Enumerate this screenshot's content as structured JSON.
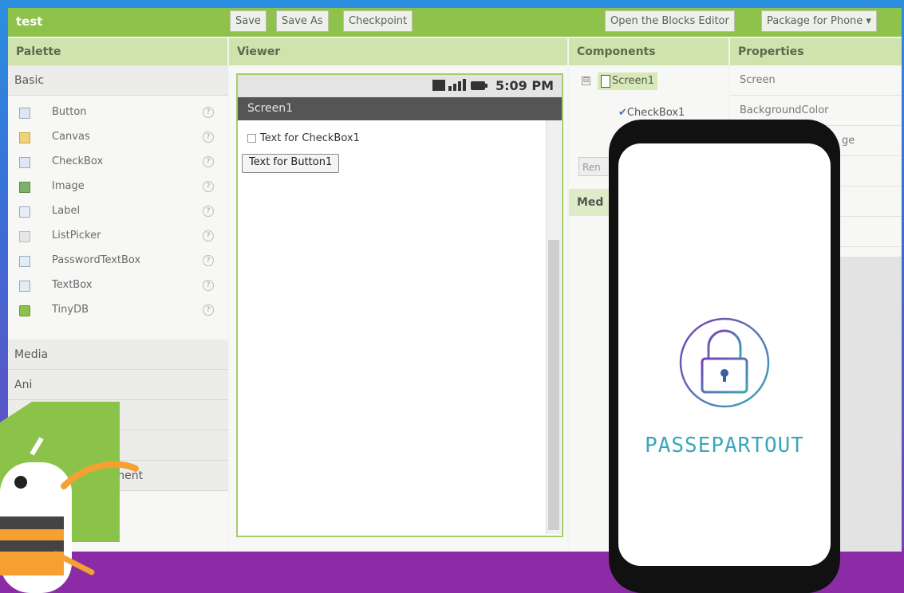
{
  "topbar": {
    "app_title": "test",
    "save": "Save",
    "save_as": "Save As",
    "checkpoint": "Checkpoint",
    "blocks_editor": "Open the Blocks Editor",
    "package": "Package for Phone ▾"
  },
  "columns": {
    "palette": "Palette",
    "viewer": "Viewer",
    "components": "Components",
    "properties": "Properties"
  },
  "palette": {
    "basic": "Basic",
    "items": [
      "Button",
      "Canvas",
      "CheckBox",
      "Image",
      "Label",
      "ListPicker",
      "PasswordTextBox",
      "TextBox",
      "TinyDB"
    ],
    "help_glyph": "?",
    "sections": [
      "Media",
      "Ani",
      "gement"
    ]
  },
  "viewer": {
    "status_time": "5:09 PM",
    "screen_title": "Screen1",
    "checkbox_text": "Text for CheckBox1",
    "button_text": "Text for Button1"
  },
  "components": {
    "tree_toggle": "⊟",
    "screen_node": "Screen1",
    "checkbox_node": "CheckBox1",
    "rename_label": "Ren",
    "media_header": "Med"
  },
  "properties": {
    "rows": [
      "Screen",
      "BackgroundColor",
      "ge"
    ]
  },
  "device": {
    "brand": "PASSEPARTOUT"
  },
  "colors": {
    "toolbar_green": "#8ec24a",
    "header_green": "#cfe3ad",
    "purple_band": "#8b2ca6",
    "brand_teal": "#3aa7b8"
  }
}
